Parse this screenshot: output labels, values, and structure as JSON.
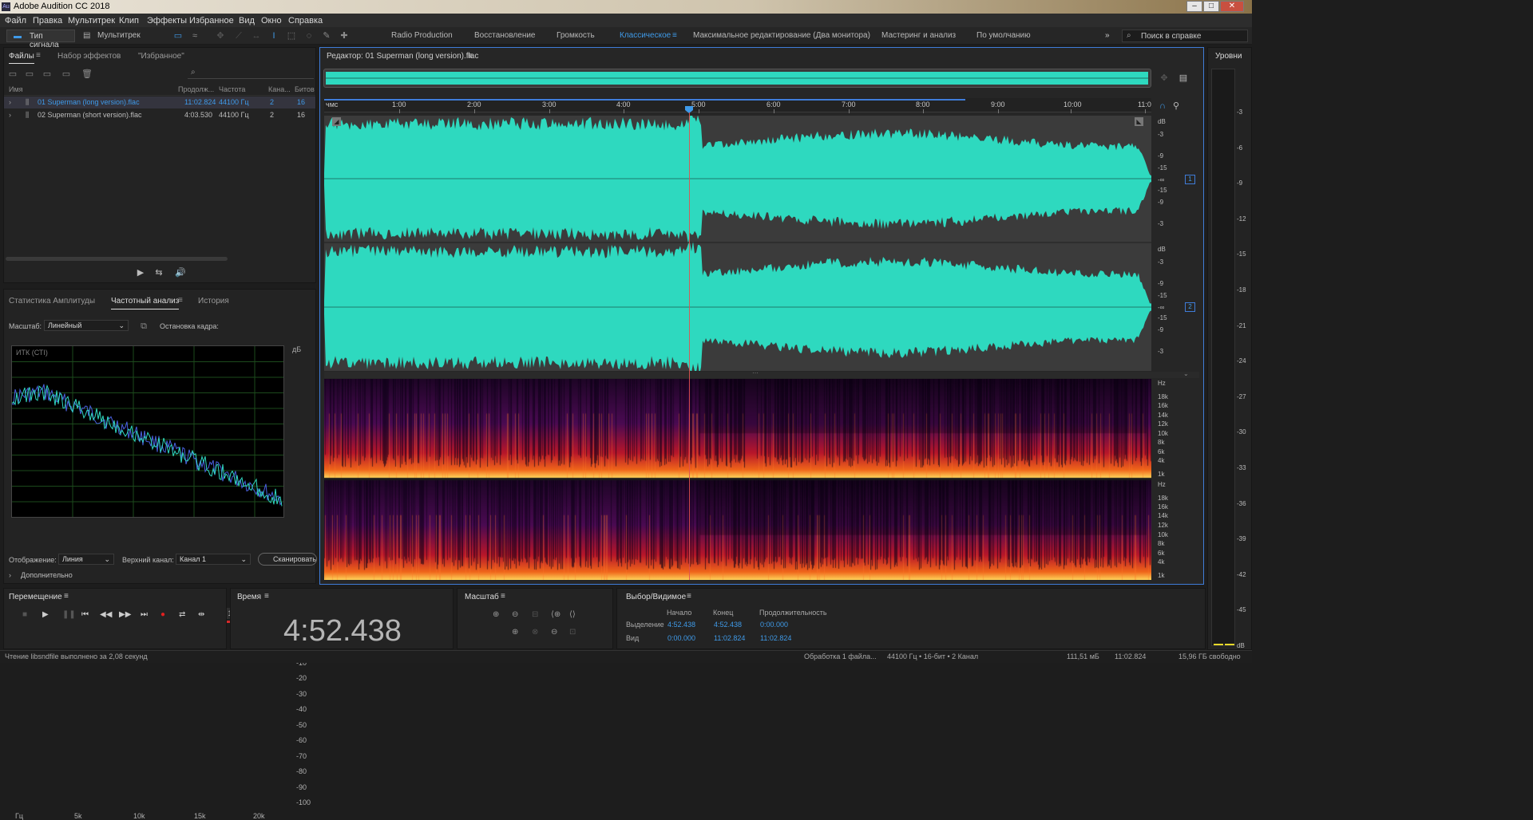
{
  "window": {
    "title": "Adobe Audition CC 2018",
    "logo": "Au"
  },
  "menu": [
    "Файл",
    "Правка",
    "Мультитрек",
    "Клип",
    "Эффекты",
    "Избранное",
    "Вид",
    "Окно",
    "Справка"
  ],
  "toolbar": {
    "view_waveform": "Тип сигнала",
    "view_multitrack": "Мультитрек",
    "workspaces": [
      "Radio Production",
      "Восстановление",
      "Громкость",
      "Классическое",
      "Максимальное редактирование (Два монитора)",
      "Мастеринг и анализ",
      "По умолчанию"
    ],
    "active_workspace": "Классическое",
    "search_placeholder": "Поиск в справке"
  },
  "files_panel": {
    "tabs": [
      "Файлы",
      "Набор эффектов",
      "\"Избранное\""
    ],
    "columns": [
      "Имя",
      "Продолж...",
      "Частота",
      "Кана...",
      "Битов"
    ],
    "rows": [
      {
        "name": "01 Superman (long version).flac",
        "duration": "11:02.824",
        "rate": "44100 Гц",
        "channels": "2",
        "bits": "16",
        "selected": true
      },
      {
        "name": "02 Superman (short version).flac",
        "duration": "4:03.530",
        "rate": "44100 Гц",
        "channels": "2",
        "bits": "16",
        "selected": false
      }
    ]
  },
  "analysis_panel": {
    "tabs": [
      "Статистика Амплитуды",
      "Частотный анализ",
      "История"
    ],
    "scale_label": "Масштаб:",
    "scale_value": "Линейный",
    "freeze_label": "Остановка кадра:",
    "freeze_buttons": [
      "1",
      "2",
      "3",
      "4",
      "5",
      "6"
    ],
    "freeze_colors": [
      "#d42a2a",
      "#e8862a",
      "#e8d82a",
      "#46c52e",
      "#2ec5a8",
      "#2a9de8"
    ],
    "graph_title": "ИТК (СТI)",
    "db_unit": "дБ",
    "db_ticks": [
      "0",
      "-10",
      "-20",
      "-30",
      "-40",
      "-50",
      "-60",
      "-70",
      "-80",
      "-90",
      "-100"
    ],
    "x_ticks": [
      "Гц",
      "5k",
      "10k",
      "15k",
      "20k"
    ],
    "display_label": "Отображение:",
    "display_value": "Линия",
    "channel_label": "Верхний канал:",
    "channel_value": "Канал 1",
    "scan_button": "Сканировать",
    "advanced": "Дополнительно"
  },
  "editor": {
    "title": "Редактор: 01 Superman (long version).flac",
    "ruler_unit": "чмс",
    "ruler_ticks": [
      "1:00",
      "2:00",
      "3:00",
      "4:00",
      "5:00",
      "6:00",
      "7:00",
      "8:00",
      "9:00",
      "10:00",
      "11:0"
    ],
    "db_ticks_ch": [
      "dB",
      "-3",
      "-9",
      "-15",
      "-∞",
      "-15",
      "-9",
      "-3"
    ],
    "hz_ticks": [
      "Hz",
      "18k",
      "16k",
      "14k",
      "12k",
      "10k",
      "8k",
      "6k",
      "4k",
      "1k"
    ],
    "channel_badges": [
      "1",
      "2"
    ],
    "playhead_time": "4:52.438",
    "total_duration": "11:02.824",
    "waveform_color": "#2ed9bf"
  },
  "levels_panel": {
    "title": "Уровни",
    "ticks": [
      "-3",
      "-6",
      "-9",
      "-12",
      "-15",
      "-18",
      "-21",
      "-24",
      "-27",
      "-30",
      "-33",
      "-36",
      "-39",
      "-42",
      "-45",
      "dB"
    ]
  },
  "transport": {
    "title": "Перемещение"
  },
  "time_panel": {
    "title": "Время",
    "value": "4:52.438"
  },
  "zoom_panel": {
    "title": "Масштаб"
  },
  "selection_panel": {
    "title": "Выбор/Видимое",
    "headers": [
      "Начало",
      "Конец",
      "Продолжительность"
    ],
    "rows": [
      {
        "label": "Выделение",
        "start": "4:52.438",
        "end": "4:52.438",
        "duration": "0:00.000"
      },
      {
        "label": "Вид",
        "start": "0:00.000",
        "end": "11:02.824",
        "duration": "11:02.824"
      }
    ]
  },
  "status": {
    "left": "Чтение libsndfile выполнено за 2,08 секунд",
    "processing": "Обработка 1 файла...",
    "format": "44100 Гц • 16-бит • 2 Канал",
    "size": "111,51 мБ",
    "duration": "11:02.824",
    "free": "15,96 ГБ свободно"
  }
}
